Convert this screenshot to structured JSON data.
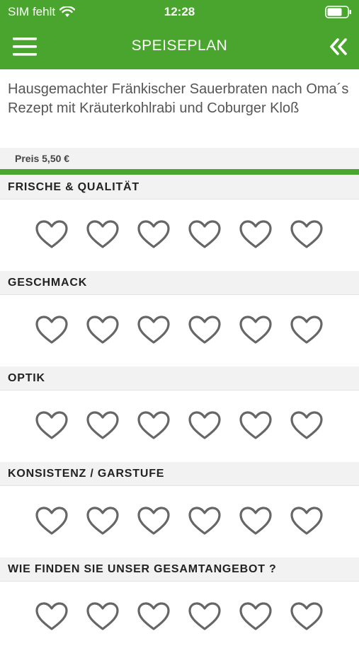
{
  "status_bar": {
    "carrier": "SIM fehlt",
    "time": "12:28",
    "wifi_icon": "wifi-icon",
    "battery_icon": "battery-icon"
  },
  "header": {
    "title": "SPEISEPLAN",
    "menu_icon": "hamburger-menu-icon",
    "back_icon": "double-chevron-left-icon"
  },
  "meal": {
    "title": "Hausgemachter Fränkischer Sauerbraten nach Oma´s Rezept mit Kräuterkohlrabi und Coburger Kloß",
    "price": "Preis 5,50 €"
  },
  "rating_categories": [
    {
      "label": "FRISCHE & QUALITÄT",
      "rating": 0,
      "max": 6
    },
    {
      "label": "GESCHMACK",
      "rating": 0,
      "max": 6
    },
    {
      "label": "OPTIK",
      "rating": 0,
      "max": 6
    },
    {
      "label": "KONSISTENZ / GARSTUFE",
      "rating": 0,
      "max": 6
    },
    {
      "label": "WIE FINDEN SIE UNSER GESAMTANGEBOT ?",
      "rating": 0,
      "max": 6
    }
  ],
  "colors": {
    "brand_green": "#4aa52e",
    "heart_outline": "#666666",
    "section_bg": "#f2f2f2"
  }
}
